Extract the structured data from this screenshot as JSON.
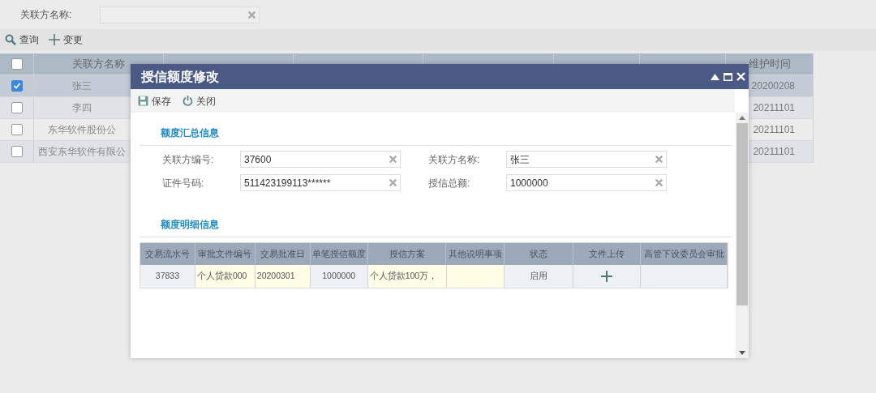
{
  "filter": {
    "label": "关联方名称:"
  },
  "toolbar": [
    {
      "kind": "search",
      "label": "查询"
    },
    {
      "kind": "plus",
      "label": "变更"
    }
  ],
  "grid": {
    "all_selected": false,
    "name_header": "关联方名称",
    "time_header": "维护时间",
    "rows": [
      {
        "selected": true,
        "name": "张三",
        "time": "20200208"
      },
      {
        "selected": false,
        "name": "李四",
        "time": "20211101"
      },
      {
        "selected": false,
        "name": "东华软件股份公",
        "time": "20211101"
      },
      {
        "selected": false,
        "name": "西安东华软件有限公",
        "time": "20211101"
      }
    ]
  },
  "dialog": {
    "title": "授信额度修改",
    "toolbar": [
      {
        "kind": "save",
        "label": "保存"
      },
      {
        "kind": "power",
        "label": "关闭"
      }
    ],
    "summary": {
      "title": "额度汇总信息",
      "fields": [
        {
          "label": "关联方编号:",
          "value": "37600"
        },
        {
          "label": "关联方名称:",
          "value": "张三"
        },
        {
          "label": "证件号码:",
          "value": "511423199113******"
        },
        {
          "label": "授信总额:",
          "value": "1000000"
        }
      ]
    },
    "detail": {
      "title": "额度明细信息",
      "columns": [
        "交易流水号",
        "审批文件编号",
        "交易批准日",
        "单笔授信额度",
        "授信方案",
        "其他说明事项",
        "状态",
        "文件上传",
        "高管下设委员会审批"
      ],
      "rows": [
        [
          {
            "kind": "text",
            "text": "37833",
            "editable": false
          },
          {
            "kind": "text",
            "text": "个人贷款000",
            "editable": true
          },
          {
            "kind": "text",
            "text": "20200301",
            "editable": true
          },
          {
            "kind": "text",
            "text": "1000000",
            "editable": false
          },
          {
            "kind": "text",
            "text": "个人贷款100万，",
            "editable": true
          },
          {
            "kind": "text",
            "text": "",
            "editable": true
          },
          {
            "kind": "text",
            "text": "启用",
            "editable": false
          },
          {
            "kind": "upload",
            "editable": false
          },
          {
            "kind": "text",
            "text": "",
            "editable": false
          }
        ]
      ]
    }
  }
}
